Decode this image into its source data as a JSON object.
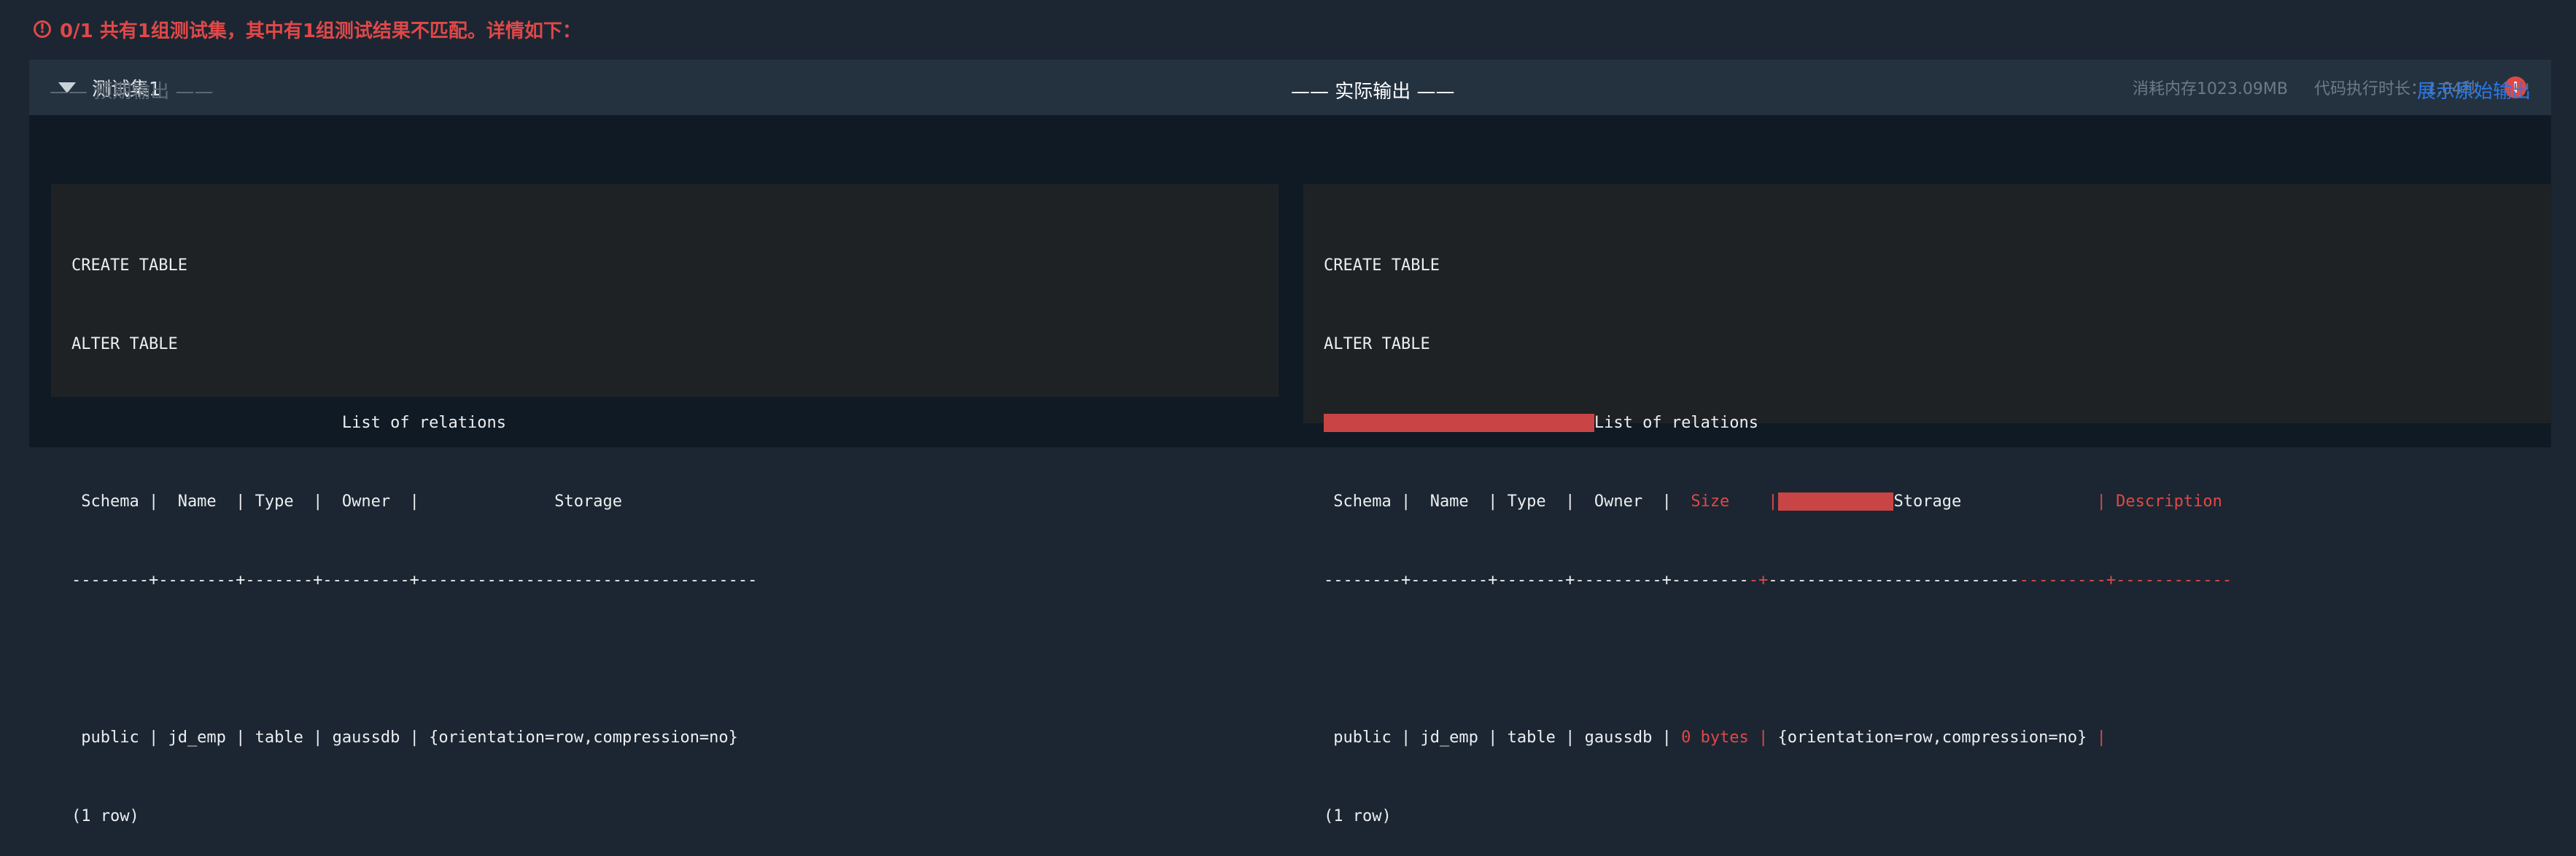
{
  "summary": {
    "icon": "alert-circle-icon",
    "text": "0/1  共有1组测试集，其中有1组测试结果不匹配。详情如下："
  },
  "test_set": {
    "name": "测试集1",
    "memory": "消耗内存1023.09MB",
    "duration": "代码执行时长：1.04秒",
    "status": "fail"
  },
  "expected": {
    "label": "—— 预期输出 ——",
    "lines": [
      "CREATE TABLE",
      "ALTER TABLE",
      "                            List of relations",
      " Schema |  Name  | Type  |  Owner  |              Storage",
      "--------+--------+-------+---------+-----------------------------------",
      " public | jd_emp | table | gaussdb | {orientation=row,compression=no}",
      "(1 row)"
    ]
  },
  "actual": {
    "label": "—— 实际输出 ——",
    "show_raw_link": "展示原始输出",
    "line1": "CREATE TABLE",
    "line2": "ALTER TABLE",
    "line3": {
      "pad": "                            ",
      "text": "List of relations"
    },
    "line4": {
      "a": " Schema |  Name  | Type  |  Owner  | ",
      "b": " Size    |",
      "c": "            ",
      "d": "Storage",
      "e": "              | Description"
    },
    "line5": {
      "a": "--------+--------+-------+---------+--------",
      "b": "-+",
      "c": "--------------------------",
      "d": "---------+------------"
    },
    "line6": {
      "a": " public | jd_emp | table | gaussdb | ",
      "b": "0 bytes |",
      "c": " {orientation=row,compression=no} ",
      "d": "|"
    },
    "line7": "(1 row)"
  },
  "colors": {
    "error": "#e04848",
    "link": "#2b78e4",
    "page_bg": "#1b2632",
    "panel_bg": "#0f1a24",
    "header_bg": "#243240",
    "code_bg": "#1f2225"
  }
}
